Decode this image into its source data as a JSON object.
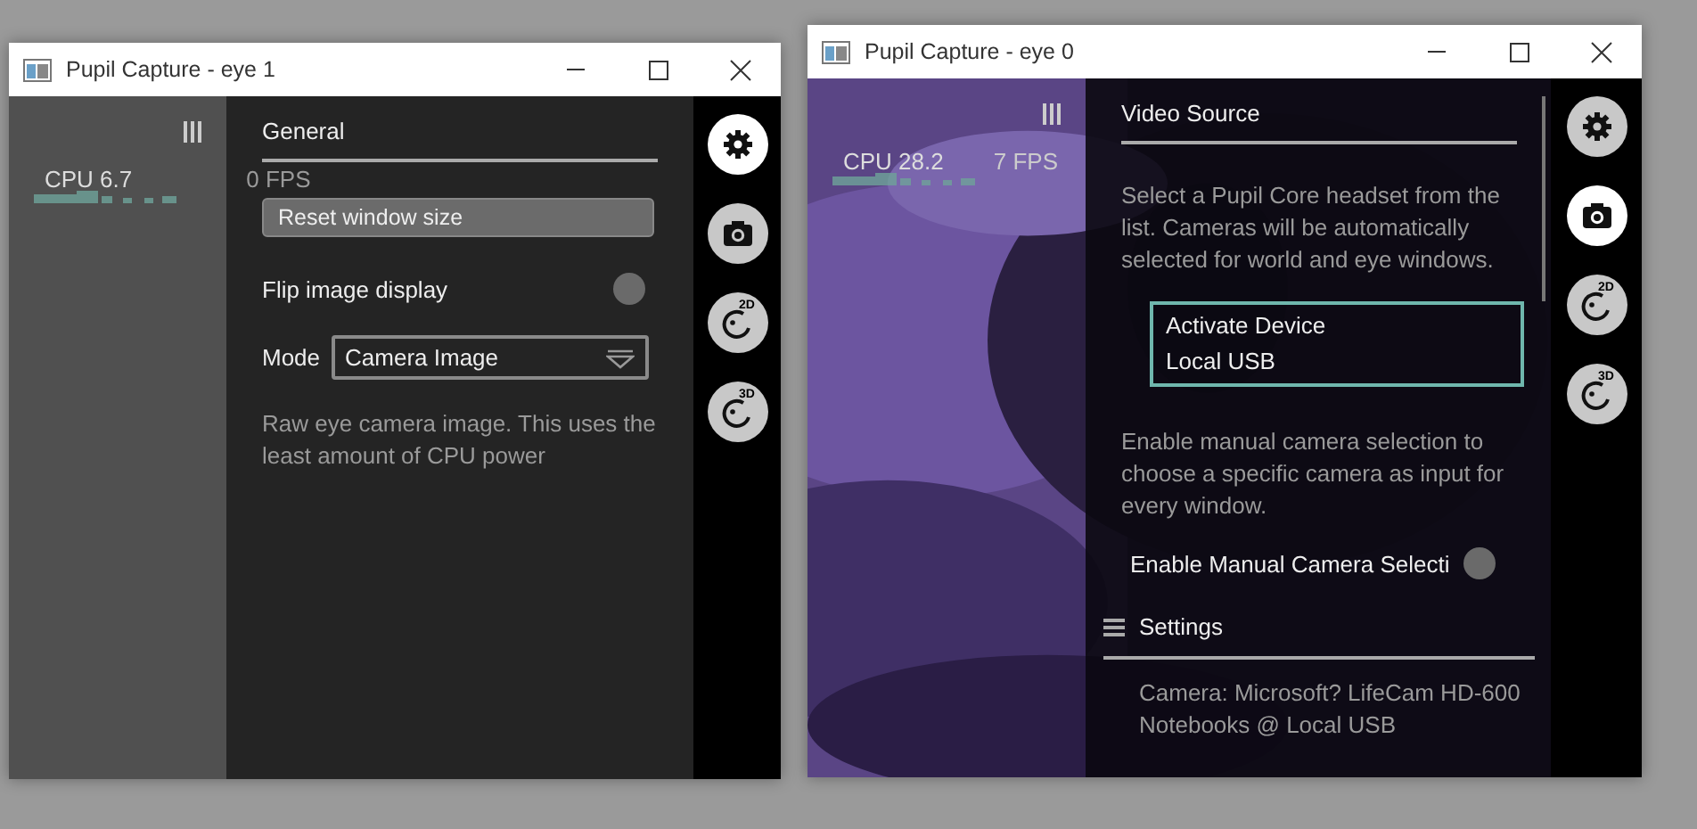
{
  "windows": [
    {
      "title": "Pupil Capture - eye 1",
      "cpu_label": "CPU 6.7",
      "fps_label": "0 FPS",
      "menu": {
        "title": "General",
        "items": [
          {
            "kind": "button",
            "label": "Reset window size"
          },
          {
            "kind": "switch",
            "label": "Flip image display",
            "on": false
          },
          {
            "kind": "select",
            "label": "Mode",
            "value": "Camera Image"
          },
          {
            "kind": "info",
            "text": "Raw eye camera image. This uses the least amount of CPU power"
          }
        ]
      },
      "icons": [
        {
          "kind": "gear",
          "selected": true
        },
        {
          "kind": "camera",
          "selected": false
        },
        {
          "kind": "detector",
          "label": "2D",
          "selected": false
        },
        {
          "kind": "detector",
          "label": "3D",
          "selected": false
        }
      ]
    },
    {
      "title": "Pupil Capture - eye 0",
      "cpu_label": "CPU 28.2",
      "fps_label": "7 FPS",
      "menu": {
        "title": "Video Source",
        "items": [
          {
            "kind": "info",
            "text": "Select a Pupil Core headset from the list. Cameras will be automatically selected for world and eye windows."
          },
          {
            "kind": "device",
            "lines": [
              "Activate Device",
              "Local USB"
            ]
          },
          {
            "kind": "info",
            "text": "Enable manual camera selection to choose a specific camera as input for every window."
          },
          {
            "kind": "switch",
            "label": "Enable Manual Camera Selecti",
            "on": false
          },
          {
            "kind": "section",
            "label": "Settings"
          },
          {
            "kind": "detail",
            "lines": [
              "Camera: Microsoft? LifeCam HD-600",
              "Notebooks @ Local USB"
            ]
          }
        ]
      },
      "icons": [
        {
          "kind": "gear",
          "selected": false
        },
        {
          "kind": "camera",
          "selected": true
        },
        {
          "kind": "detector",
          "label": "2D",
          "selected": false
        },
        {
          "kind": "detector",
          "label": "3D",
          "selected": false
        }
      ]
    }
  ]
}
